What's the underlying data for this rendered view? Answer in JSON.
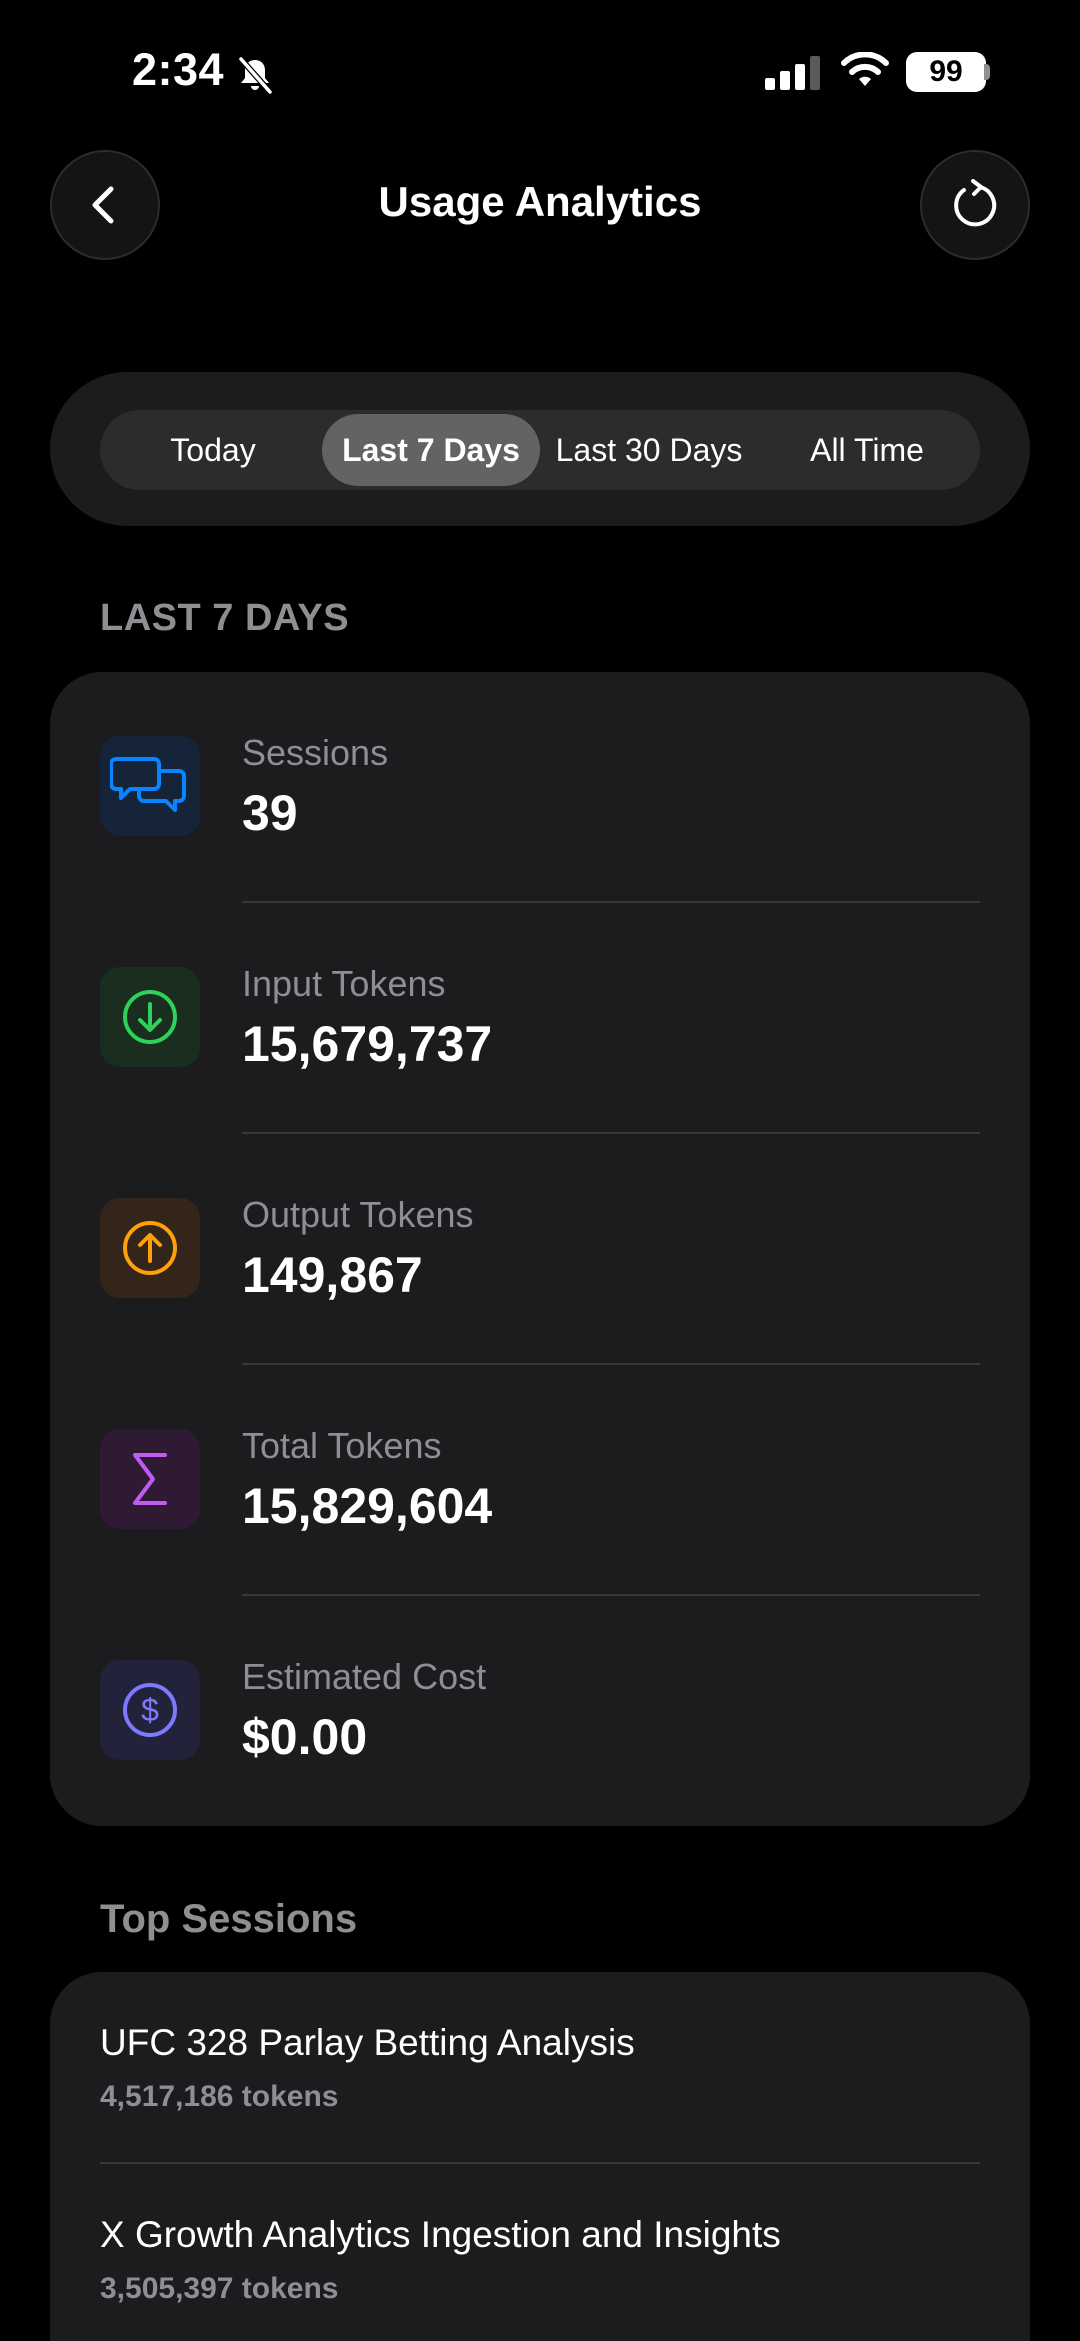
{
  "status_bar": {
    "time": "2:34",
    "battery": "99"
  },
  "header": {
    "title": "Usage Analytics"
  },
  "segments": [
    {
      "label": "Today"
    },
    {
      "label": "Last 7 Days"
    },
    {
      "label": "Last 30 Days"
    },
    {
      "label": "All Time"
    }
  ],
  "selected_segment": "Last 7 Days",
  "section_label": "LAST 7 DAYS",
  "stats": [
    {
      "label": "Sessions",
      "value": "39",
      "icon": "chat-bubbles-icon",
      "color": "#0a84ff"
    },
    {
      "label": "Input Tokens",
      "value": "15,679,737",
      "icon": "arrow-down-circle-icon",
      "color": "#30d158"
    },
    {
      "label": "Output Tokens",
      "value": "149,867",
      "icon": "arrow-up-circle-icon",
      "color": "#ff9f0a"
    },
    {
      "label": "Total Tokens",
      "value": "15,829,604",
      "icon": "sigma-icon",
      "color": "#bf5af2"
    },
    {
      "label": "Estimated Cost",
      "value": "$0.00",
      "icon": "dollar-circle-icon",
      "color": "#7d7aff"
    }
  ],
  "top_sessions": {
    "label": "Top Sessions",
    "items": [
      {
        "title": "UFC 328 Parlay Betting Analysis",
        "tokens": "4,517,186 tokens"
      },
      {
        "title": "X Growth Analytics Ingestion and Insights",
        "tokens": "3,505,397 tokens"
      }
    ]
  }
}
